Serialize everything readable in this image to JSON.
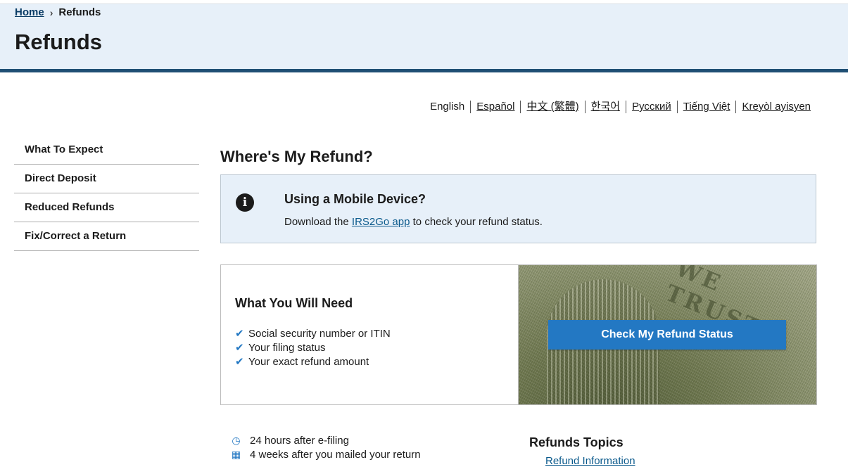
{
  "breadcrumb": {
    "home": "Home",
    "separator": "›",
    "current": "Refunds"
  },
  "page": {
    "title": "Refunds"
  },
  "languages": [
    "English",
    "Español",
    "中文 (繁體)",
    "한국어",
    "Русский",
    "Tiếng Việt",
    "Kreyòl ayisyen"
  ],
  "sidenav": {
    "items": [
      "What To Expect",
      "Direct Deposit",
      "Reduced Refunds",
      "Fix/Correct a Return"
    ]
  },
  "main": {
    "heading": "Where's My Refund?"
  },
  "alert": {
    "icon": "info-circle-icon",
    "title": "Using a Mobile Device?",
    "text_before": "Download the ",
    "link": "IRS2Go app",
    "text_after": " to check your refund status."
  },
  "needs": {
    "title": "What You Will Need",
    "items": [
      "Social security number or ITIN",
      "Your filing status",
      "Your exact refund amount"
    ],
    "check_icon": "checkmark-icon"
  },
  "hero": {
    "button": "Check My Refund Status",
    "watermark": "WE TRUST"
  },
  "timeline": {
    "items": [
      {
        "icon": "clock-icon",
        "text": "24 hours after e-filing"
      },
      {
        "icon": "calendar-icon",
        "text": "4 weeks after you mailed your return"
      }
    ]
  },
  "topics": {
    "title": "Refunds Topics",
    "first_link": "Refund Information"
  },
  "colors": {
    "accent": "#2378c3",
    "header_bg": "#e7f0f9",
    "header_border": "#1f4f74",
    "link": "#0b5a8c"
  }
}
